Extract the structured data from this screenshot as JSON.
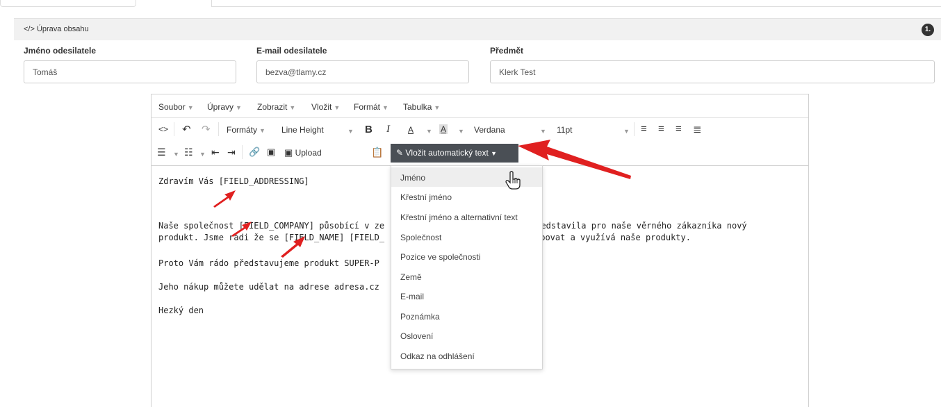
{
  "panel": {
    "title": "</> Úprava obsahu",
    "badge": "1."
  },
  "fields": {
    "sender_name": {
      "label": "Jméno odesilatele",
      "value": "Tomáš"
    },
    "sender_email": {
      "label": "E-mail odesilatele",
      "value": "bezva@tlamy.cz"
    },
    "subject": {
      "label": "Předmět",
      "value": "Klerk Test"
    }
  },
  "editor": {
    "menu": [
      "Soubor",
      "Úpravy",
      "Zobrazit",
      "Vložit",
      "Formát",
      "Tabulka"
    ],
    "toolbar": {
      "formats": "Formáty",
      "line_height": "Line Height",
      "font_family": "Verdana",
      "font_size": "11pt",
      "upload": "Upload",
      "autotext": "Vložit automatický text"
    },
    "content": {
      "line1": "Zdravím Vás [FIELD_ADDRESSING]",
      "line2a": "Naše společnost [FIELD_COMPANY] působící v ze",
      "line2b": "představila pro naše věrného zákazníka nový",
      "line3a": "produkt. Jsme rádi že se [FIELD_NAME] [FIELD_",
      "line3b": "upovat a využívá naše produkty.",
      "line4": "Proto Vám rádo představujeme produkt SUPER-P",
      "line5": "Jeho nákup můžete udělat na adrese adresa.cz",
      "line6": "Hezký den"
    }
  },
  "dropdown": {
    "items": [
      "Jméno",
      "Křestní jméno",
      "Křestní jméno a alternativní text",
      "Společnost",
      "Pozice ve společnosti",
      "Země",
      "E-mail",
      "Poznámka",
      "Oslovení",
      "Odkaz na odhlášení"
    ]
  },
  "colors": {
    "annotation_arrow": "#e02020",
    "autotext_button": "#4a4f55"
  }
}
